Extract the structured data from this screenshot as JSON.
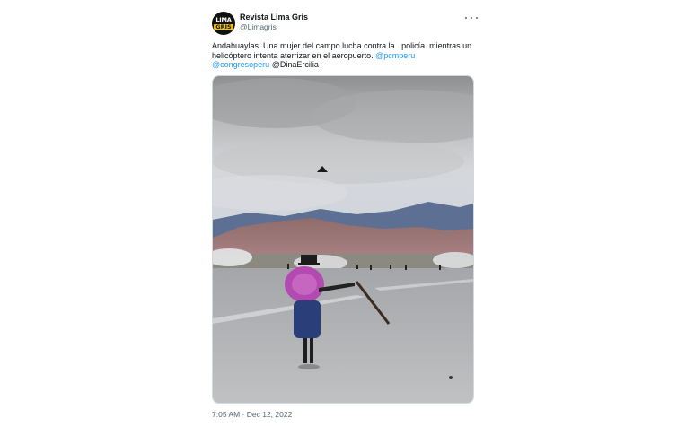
{
  "tweet": {
    "author": {
      "display_name": "Revista Lima Gris",
      "handle": "@Limagris",
      "avatar_text_top": "LIMA",
      "avatar_text_bottom": "GRIS"
    },
    "text_line_1": "Andahuaylas. Una mujer del campo lucha contra la   policía  mientras un",
    "text_line_2": "helicóptero intenta aterrizar en el aeropuerto. ",
    "mention_1": "@pcmperu",
    "mention_2": "@congresoperu",
    "mention_3": "@DinaErcilia",
    "timestamp": "7:05 AM · Dec 12, 2022",
    "more_icon": "more-dots-icon"
  },
  "colors": {
    "link": "#1d9bf0",
    "text": "#0f1419",
    "muted": "#536471",
    "border": "#cfd9de"
  }
}
